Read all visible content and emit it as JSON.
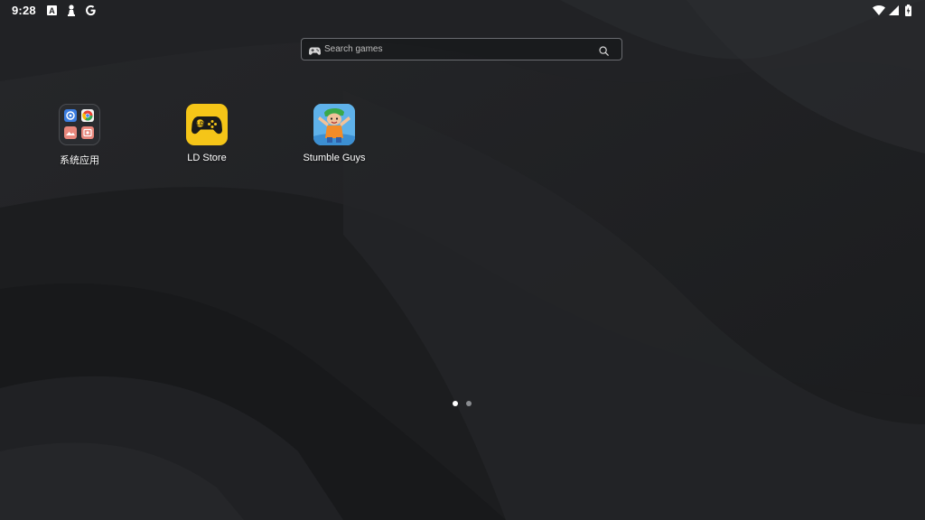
{
  "status_bar": {
    "time": "9:28",
    "left_icons": [
      "text-a-notification-icon",
      "pawn-notification-icon",
      "google-notification-icon"
    ],
    "right_icons": [
      "wifi-icon",
      "cell-signal-icon",
      "battery-charging-icon"
    ],
    "google_letter": "G",
    "a_letter": "A"
  },
  "search": {
    "placeholder": "Search games",
    "icon_left": "gamepad-icon",
    "icon_right": "search-icon"
  },
  "apps": [
    {
      "label": "系统应用",
      "icon": "system-apps-folder-icon"
    },
    {
      "label": "LD Store",
      "icon": "ld-store-gamepad-icon"
    },
    {
      "label": "Stumble Guys",
      "icon": "stumble-guys-icon"
    }
  ],
  "pages": {
    "count": 2,
    "current": 1
  },
  "colors": {
    "ld_store_yellow": "#f5c518",
    "wallpaper_dark": "#1e1f21"
  }
}
